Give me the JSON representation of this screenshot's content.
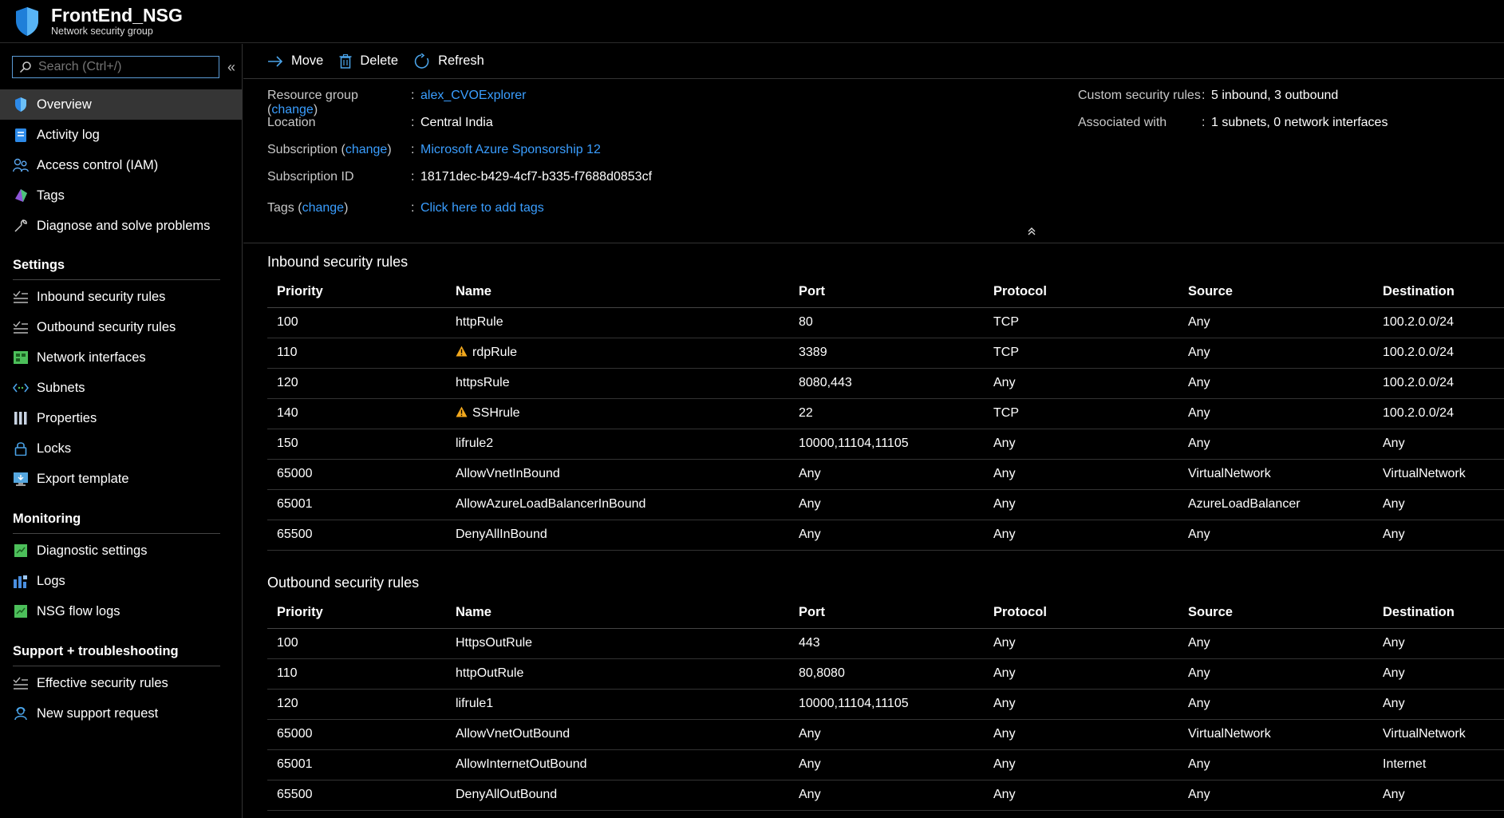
{
  "header": {
    "title": "FrontEnd_NSG",
    "subtitle": "Network security group"
  },
  "sidebar": {
    "search_placeholder": "Search (Ctrl+/)",
    "collapse": "«",
    "items": [
      {
        "label": "Overview",
        "icon": "shield-icon"
      },
      {
        "label": "Activity log",
        "icon": "activity-log-icon"
      },
      {
        "label": "Access control (IAM)",
        "icon": "people-icon"
      },
      {
        "label": "Tags",
        "icon": "tag-icon"
      },
      {
        "label": "Diagnose and solve problems",
        "icon": "wrench-icon"
      }
    ],
    "settings_title": "Settings",
    "settings_items": [
      {
        "label": "Inbound security rules",
        "icon": "inbound-rules-icon"
      },
      {
        "label": "Outbound security rules",
        "icon": "outbound-rules-icon"
      },
      {
        "label": "Network interfaces",
        "icon": "network-interface-icon"
      },
      {
        "label": "Subnets",
        "icon": "subnet-icon"
      },
      {
        "label": "Properties",
        "icon": "properties-icon"
      },
      {
        "label": "Locks",
        "icon": "lock-icon"
      },
      {
        "label": "Export template",
        "icon": "export-template-icon"
      }
    ],
    "monitoring_title": "Monitoring",
    "monitoring_items": [
      {
        "label": "Diagnostic settings",
        "icon": "diagnostic-icon"
      },
      {
        "label": "Logs",
        "icon": "logs-icon"
      },
      {
        "label": "NSG flow logs",
        "icon": "flow-logs-icon"
      }
    ],
    "support_title": "Support + troubleshooting",
    "support_items": [
      {
        "label": "Effective security rules",
        "icon": "effective-rules-icon"
      },
      {
        "label": "New support request",
        "icon": "support-person-icon"
      }
    ]
  },
  "toolbar": {
    "move": "Move",
    "delete": "Delete",
    "refresh": "Refresh"
  },
  "essentials": {
    "resource_group_label": "Resource group",
    "change": "change",
    "resource_group_value": "alex_CVOExplorer",
    "location_label": "Location",
    "location_value": "Central India",
    "subscription_label": "Subscription",
    "subscription_value": "Microsoft Azure Sponsorship 12",
    "subscription_id_label": "Subscription ID",
    "subscription_id_value": "18171dec-b429-4cf7-b335-f7688d0853cf",
    "tags_label": "Tags",
    "tags_value": "Click here to add tags",
    "custom_rules_label": "Custom security rules",
    "custom_rules_value": "5 inbound, 3 outbound",
    "associated_label": "Associated with",
    "associated_value": "1 subnets, 0 network interfaces"
  },
  "inbound": {
    "title": "Inbound security rules",
    "columns": [
      "Priority",
      "Name",
      "Port",
      "Protocol",
      "Source",
      "Destination"
    ],
    "rows": [
      {
        "priority": "100",
        "name": "httpRule",
        "warn": false,
        "port": "80",
        "protocol": "TCP",
        "source": "Any",
        "destination": "100.2.0.0/24"
      },
      {
        "priority": "110",
        "name": "rdpRule",
        "warn": true,
        "port": "3389",
        "protocol": "TCP",
        "source": "Any",
        "destination": "100.2.0.0/24"
      },
      {
        "priority": "120",
        "name": "httpsRule",
        "warn": false,
        "port": "8080,443",
        "protocol": "Any",
        "source": "Any",
        "destination": "100.2.0.0/24"
      },
      {
        "priority": "140",
        "name": "SSHrule",
        "warn": true,
        "port": "22",
        "protocol": "TCP",
        "source": "Any",
        "destination": "100.2.0.0/24"
      },
      {
        "priority": "150",
        "name": "lifrule2",
        "warn": false,
        "port": "10000,11104,11105",
        "protocol": "Any",
        "source": "Any",
        "destination": "Any"
      },
      {
        "priority": "65000",
        "name": "AllowVnetInBound",
        "warn": false,
        "port": "Any",
        "protocol": "Any",
        "source": "VirtualNetwork",
        "destination": "VirtualNetwork"
      },
      {
        "priority": "65001",
        "name": "AllowAzureLoadBalancerInBound",
        "warn": false,
        "port": "Any",
        "protocol": "Any",
        "source": "AzureLoadBalancer",
        "destination": "Any"
      },
      {
        "priority": "65500",
        "name": "DenyAllInBound",
        "warn": false,
        "port": "Any",
        "protocol": "Any",
        "source": "Any",
        "destination": "Any"
      }
    ]
  },
  "outbound": {
    "title": "Outbound security rules",
    "columns": [
      "Priority",
      "Name",
      "Port",
      "Protocol",
      "Source",
      "Destination"
    ],
    "rows": [
      {
        "priority": "100",
        "name": "HttpsOutRule",
        "warn": false,
        "port": "443",
        "protocol": "Any",
        "source": "Any",
        "destination": "Any"
      },
      {
        "priority": "110",
        "name": "httpOutRule",
        "warn": false,
        "port": "80,8080",
        "protocol": "Any",
        "source": "Any",
        "destination": "Any"
      },
      {
        "priority": "120",
        "name": "lifrule1",
        "warn": false,
        "port": "10000,11104,11105",
        "protocol": "Any",
        "source": "Any",
        "destination": "Any"
      },
      {
        "priority": "65000",
        "name": "AllowVnetOutBound",
        "warn": false,
        "port": "Any",
        "protocol": "Any",
        "source": "VirtualNetwork",
        "destination": "VirtualNetwork"
      },
      {
        "priority": "65001",
        "name": "AllowInternetOutBound",
        "warn": false,
        "port": "Any",
        "protocol": "Any",
        "source": "Any",
        "destination": "Internet"
      },
      {
        "priority": "65500",
        "name": "DenyAllOutBound",
        "warn": false,
        "port": "Any",
        "protocol": "Any",
        "source": "Any",
        "destination": "Any"
      }
    ]
  },
  "colors": {
    "accent": "#3a9eff",
    "warning": "#f2a81d",
    "background": "#000000"
  }
}
